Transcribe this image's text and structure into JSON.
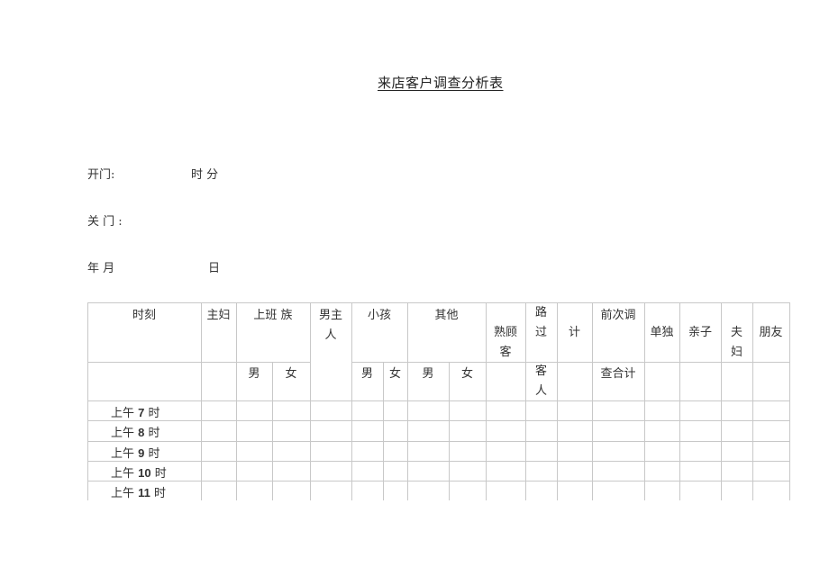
{
  "document": {
    "title": "来店客户调查分析表",
    "open_label": "开门:",
    "open_time_units": "时 分",
    "close_label": "关 门 :",
    "date_label": "年 月",
    "date_day": "日"
  },
  "table": {
    "headers_top": {
      "time": "时刻",
      "housewife": "主妇",
      "office_worker": "上班 族",
      "male_host": "男主\n人",
      "child": "小孩",
      "other": "其他",
      "regular": "熟顾\n客",
      "passerby": "路\n过",
      "total": "计",
      "prev_survey": "前次调",
      "alone": "单独",
      "parent_child": "亲子",
      "couple": "夫\n妇",
      "friends": "朋友"
    },
    "headers_sub": {
      "office_male": "男",
      "office_female": "女",
      "child_male": "男",
      "child_female": "女",
      "other_male": "男",
      "other_female": "女",
      "passerby_guest": "客\n人",
      "prev_survey_total": "查合计"
    },
    "rows": [
      {
        "prefix": "上午",
        "hour": "7",
        "suffix": "时"
      },
      {
        "prefix": "上午",
        "hour": "8",
        "suffix": "时"
      },
      {
        "prefix": "上午",
        "hour": "9",
        "suffix": "时"
      },
      {
        "prefix": "上午",
        "hour": "10",
        "suffix": "时"
      },
      {
        "prefix": "上午",
        "hour": "11",
        "suffix": "时"
      }
    ]
  }
}
